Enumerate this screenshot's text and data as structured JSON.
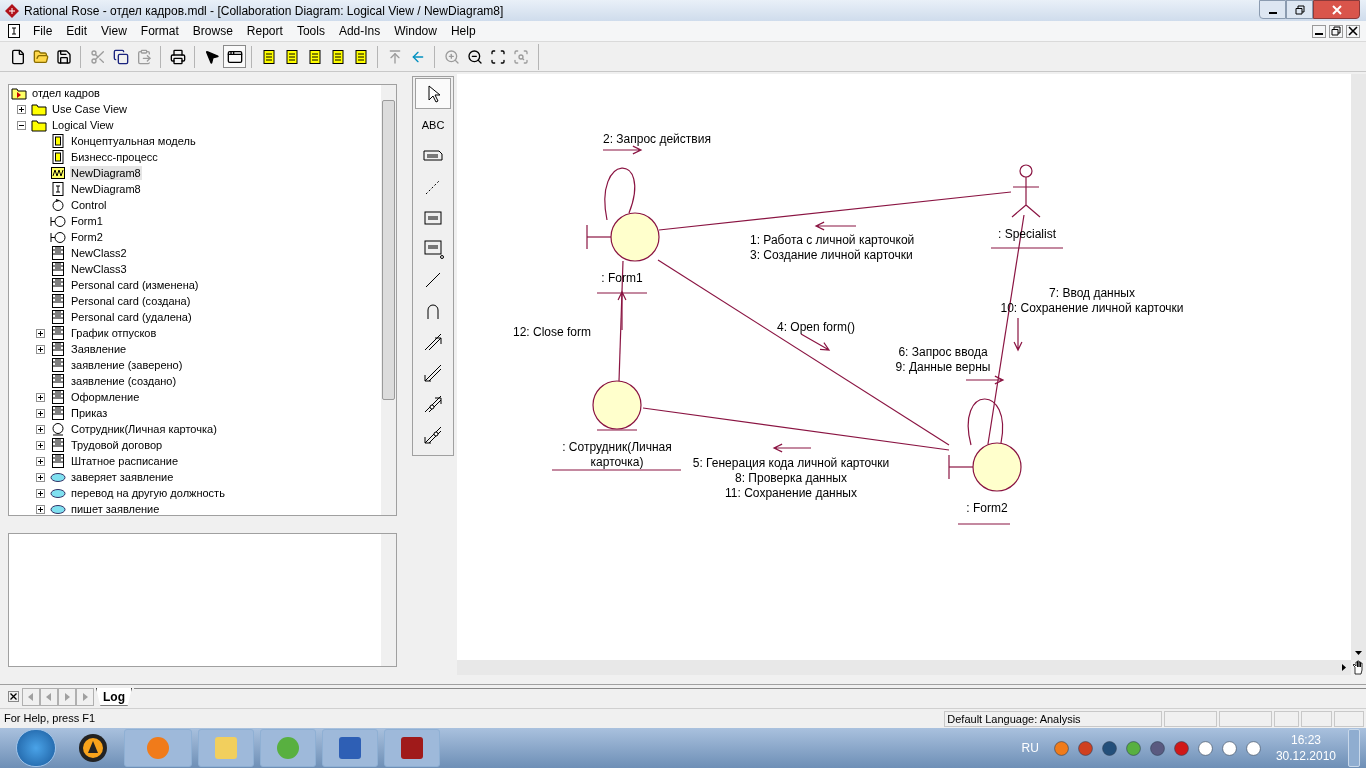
{
  "window": {
    "title": "Rational Rose - отдел кадров.mdl - [Collaboration Diagram: Logical View / NewDiagram8]"
  },
  "menu": [
    "File",
    "Edit",
    "View",
    "Format",
    "Browse",
    "Report",
    "Tools",
    "Add-Ins",
    "Window",
    "Help"
  ],
  "toolbar": [
    {
      "kind": "new",
      "disabled": false,
      "pressed": false
    },
    {
      "kind": "open",
      "disabled": false,
      "pressed": false
    },
    {
      "kind": "save",
      "disabled": false,
      "pressed": false
    },
    {
      "kind": "cut",
      "disabled": true,
      "pressed": false
    },
    {
      "kind": "copy",
      "disabled": false,
      "pressed": false
    },
    {
      "kind": "paste",
      "disabled": true,
      "pressed": false
    },
    {
      "kind": "print",
      "disabled": false,
      "pressed": false
    },
    {
      "kind": "context-help",
      "disabled": false,
      "pressed": false
    },
    {
      "kind": "browser",
      "disabled": false,
      "pressed": true
    },
    {
      "kind": "class-diagram",
      "disabled": false,
      "pressed": false
    },
    {
      "kind": "interaction-diagram",
      "disabled": false,
      "pressed": false
    },
    {
      "kind": "component-diagram",
      "disabled": false,
      "pressed": false
    },
    {
      "kind": "statechart-diagram",
      "disabled": false,
      "pressed": false
    },
    {
      "kind": "deployment-diagram",
      "disabled": false,
      "pressed": false
    },
    {
      "kind": "parent",
      "disabled": true,
      "pressed": false
    },
    {
      "kind": "previous",
      "disabled": false,
      "pressed": false
    },
    {
      "kind": "zoom-in",
      "disabled": true,
      "pressed": false
    },
    {
      "kind": "zoom-out",
      "disabled": false,
      "pressed": false
    },
    {
      "kind": "fit",
      "disabled": false,
      "pressed": false
    },
    {
      "kind": "undo-fit",
      "disabled": true,
      "pressed": false
    }
  ],
  "tree": {
    "items": [
      {
        "label": "отдел кадров",
        "kind": "model",
        "selected": false,
        "children": [
          {
            "label": "Use Case View",
            "kind": "folder",
            "selected": false,
            "expanded": false
          },
          {
            "label": "Logical View",
            "kind": "folder",
            "selected": false,
            "expanded": true,
            "children": [
              {
                "label": "Концептуальная модель",
                "kind": "class-diagram",
                "selected": false
              },
              {
                "label": "Бизнесс-процесс",
                "kind": "class-diagram",
                "selected": false
              },
              {
                "label": "NewDiagram8",
                "kind": "collaboration-diagram",
                "selected": true
              },
              {
                "label": "NewDiagram8",
                "kind": "sequence-diagram",
                "selected": false
              },
              {
                "label": "Control",
                "kind": "control",
                "selected": false
              },
              {
                "label": "Form1",
                "kind": "boundary",
                "selected": false
              },
              {
                "label": "Form2",
                "kind": "boundary",
                "selected": false
              },
              {
                "label": "NewClass2",
                "kind": "class",
                "selected": false
              },
              {
                "label": "NewClass3",
                "kind": "class",
                "selected": false
              },
              {
                "label": "Personal card (изменена)",
                "kind": "class",
                "selected": false
              },
              {
                "label": "Personal card (создана)",
                "kind": "class",
                "selected": false
              },
              {
                "label": "Personal card (удалена)",
                "kind": "class",
                "selected": false
              },
              {
                "label": "График отпусков",
                "kind": "class",
                "selected": false,
                "expanded": false
              },
              {
                "label": "Заявление",
                "kind": "class",
                "selected": false,
                "expanded": false
              },
              {
                "label": "заявление (заверено)",
                "kind": "class",
                "selected": false
              },
              {
                "label": "заявление (создано)",
                "kind": "class",
                "selected": false
              },
              {
                "label": "Оформление",
                "kind": "class",
                "selected": false,
                "expanded": false
              },
              {
                "label": "Приказ",
                "kind": "class",
                "selected": false,
                "expanded": false
              },
              {
                "label": "Сотрудник(Личная карточка)",
                "kind": "entity",
                "selected": false,
                "expanded": false
              },
              {
                "label": "Трудовой договор",
                "kind": "class",
                "selected": false,
                "expanded": false
              },
              {
                "label": "Штатное расписание",
                "kind": "class",
                "selected": false,
                "expanded": false
              },
              {
                "label": "заверяет заявление",
                "kind": "use-case",
                "selected": false,
                "expanded": false
              },
              {
                "label": "перевод на другую должность",
                "kind": "use-case",
                "selected": false,
                "expanded": false
              },
              {
                "label": "пишет заявление",
                "kind": "use-case",
                "selected": false,
                "expanded": false
              }
            ]
          }
        ]
      }
    ]
  },
  "toolbox": [
    {
      "kind": "selector",
      "selected": true
    },
    {
      "kind": "text",
      "label": "ABC",
      "selected": false
    },
    {
      "kind": "note",
      "selected": false
    },
    {
      "kind": "anchor",
      "selected": false
    },
    {
      "kind": "object",
      "selected": false
    },
    {
      "kind": "class-instance",
      "selected": false
    },
    {
      "kind": "link",
      "selected": false
    },
    {
      "kind": "self-link",
      "selected": false
    },
    {
      "kind": "message",
      "selected": false
    },
    {
      "kind": "reverse-message",
      "selected": false
    },
    {
      "kind": "data-token",
      "selected": false
    },
    {
      "kind": "reverse-data-token",
      "selected": false
    }
  ],
  "diagram": {
    "objects": [
      {
        "name": ": Form1",
        "kind": "boundary"
      },
      {
        "name": ": Specialist",
        "kind": "actor"
      },
      {
        "name": ": Сотрудник(Личная карточка)",
        "kind": "entity"
      },
      {
        "name": ": Form2",
        "kind": "boundary"
      }
    ],
    "links": [
      {
        "messages": [
          "2: Запрос действия"
        ]
      },
      {
        "messages": [
          "1: Работа с личной карточкой",
          "3: Создание личной карточки"
        ]
      },
      {
        "messages": [
          "12: Close form"
        ]
      },
      {
        "messages": [
          "4: Open form()"
        ]
      },
      {
        "messages": [
          "5: Генерация кода личной карточки",
          "8: Проверка данных",
          "11: Сохранение данных"
        ]
      },
      {
        "messages": [
          "7: Ввод данных",
          "10: Сохранение личной карточки"
        ]
      },
      {
        "messages": [
          "6: Запрос ввода",
          "9: Данные верны"
        ]
      }
    ]
  },
  "log_tabs": [
    {
      "label": "Log",
      "selected": true
    }
  ],
  "status_bar": {
    "help": "For Help, press F1",
    "language": "Default Language: Analysis"
  },
  "taskbar": {
    "language": "RU",
    "time": "16:23",
    "date": "30.12.2010"
  }
}
